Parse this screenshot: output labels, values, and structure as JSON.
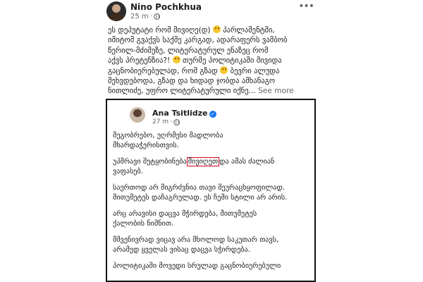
{
  "outer_post": {
    "author": "Nino Pochkhua",
    "time": "25 m",
    "meta_separator": "·",
    "more_icon": "more-horizontal-icon",
    "lines": [
      [
        "ეს დეპუტატი რომ მივიღე(დ) ",
        "emoji",
        " პარლამენტში,"
      ],
      [
        "იმიტომ გვაქვს საქმე კარგად, ადარაფერს ვამბობ"
      ],
      [
        "წერილ-მძიმეზე, ლიტერატურულ ენაზეც რომ"
      ],
      [
        "აქვს პრეტენზია?! ",
        "emoji",
        " თურმე პოლიტიკაში მივიდა"
      ],
      [
        "გაცნობიერებულად, რომ გზად ",
        "emoji",
        " ბევრი ალუდა"
      ],
      [
        "შეხვდებოდა, გზად და ხიდად ჯობდა ამხანაგო"
      ],
      [
        "ნითლიძე, უფრო ლიტერატურული იქნე..."
      ]
    ],
    "see_more": "See more"
  },
  "embedded_screenshot": {
    "author": "Ana Tsitlidze",
    "verified_icon": "verified-badge-icon",
    "time": "27 m",
    "meta_separator": "·",
    "paragraphs": [
      [
        "მეგობრებო, უღრმესი მადლობა",
        "მხარდაჭერისთვის."
      ],
      [
        "უპმრავი შეტყობინება|მივიღეთ|და ამას ძალიან",
        "ვაფასებ."
      ],
      [
        "საერთოდ არ მიგრძვნია თავი შეურაცხყოფილად.",
        "მითუმეტეს დაჩაგრულად. ეს ჩემი სტილი არ არის."
      ],
      [
        "არც არავისი დაცვა მჭირდება, მითუმეტეს",
        "ქალობის ნიშნით."
      ],
      [
        "მშვენივრად ვიცავ არა მხოლოდ საკუთარ თავს,",
        "არამედ ყველას ვისაც დაცვა სჭირდება."
      ],
      [
        "პოლიტიკაში მოვედი სრულად გაცნობიერებული"
      ]
    ]
  }
}
